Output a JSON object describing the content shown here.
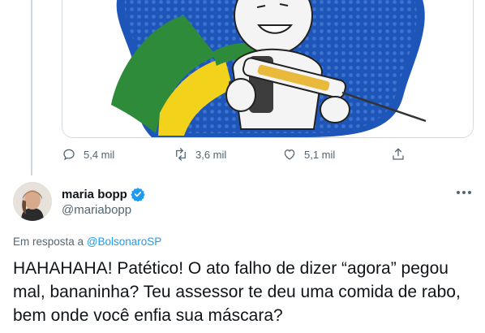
{
  "previous_tweet": {
    "media_description_icon": "vaccine-character-illustration",
    "actions": {
      "reply_count": "5,4 mil",
      "retweet_count": "3,6 mil",
      "like_count": "5,1 mil"
    }
  },
  "tweet": {
    "author_name": "maria bopp",
    "author_handle": "@mariabopp",
    "reply_prefix": "Em resposta a",
    "reply_to": "@BolsonaroSP",
    "text": "HAHAHAHA! Patético! O ato falho de dizer “agora” pegou mal, bananinha? Teu assessor te deu uma comida de rabo, bem onde você enfia sua máscara?"
  },
  "colors": {
    "accent": "#1d9bf0",
    "muted": "#536471",
    "border": "#cfd9de"
  }
}
